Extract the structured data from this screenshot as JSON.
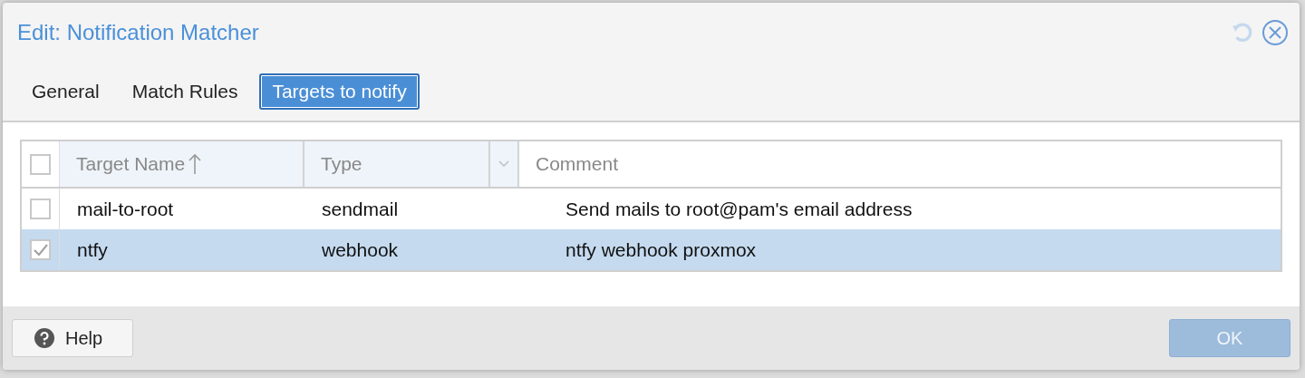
{
  "dialog": {
    "title": "Edit: Notification Matcher"
  },
  "tabs": [
    {
      "label": "General",
      "selected": false
    },
    {
      "label": "Match Rules",
      "selected": false
    },
    {
      "label": "Targets to notify",
      "selected": true
    }
  ],
  "table": {
    "select_all_checked": false,
    "columns": [
      "Target Name",
      "Type",
      "Comment"
    ],
    "rows": [
      {
        "checked": false,
        "selected": false,
        "cells": [
          "mail-to-root",
          "sendmail",
          "Send mails to root@pam's email address"
        ]
      },
      {
        "checked": true,
        "selected": true,
        "cells": [
          "ntfy",
          "webhook",
          "ntfy webhook proxmox"
        ]
      }
    ]
  },
  "footer": {
    "help": "Help",
    "ok": {
      "label": "OK",
      "disabled": true
    }
  }
}
